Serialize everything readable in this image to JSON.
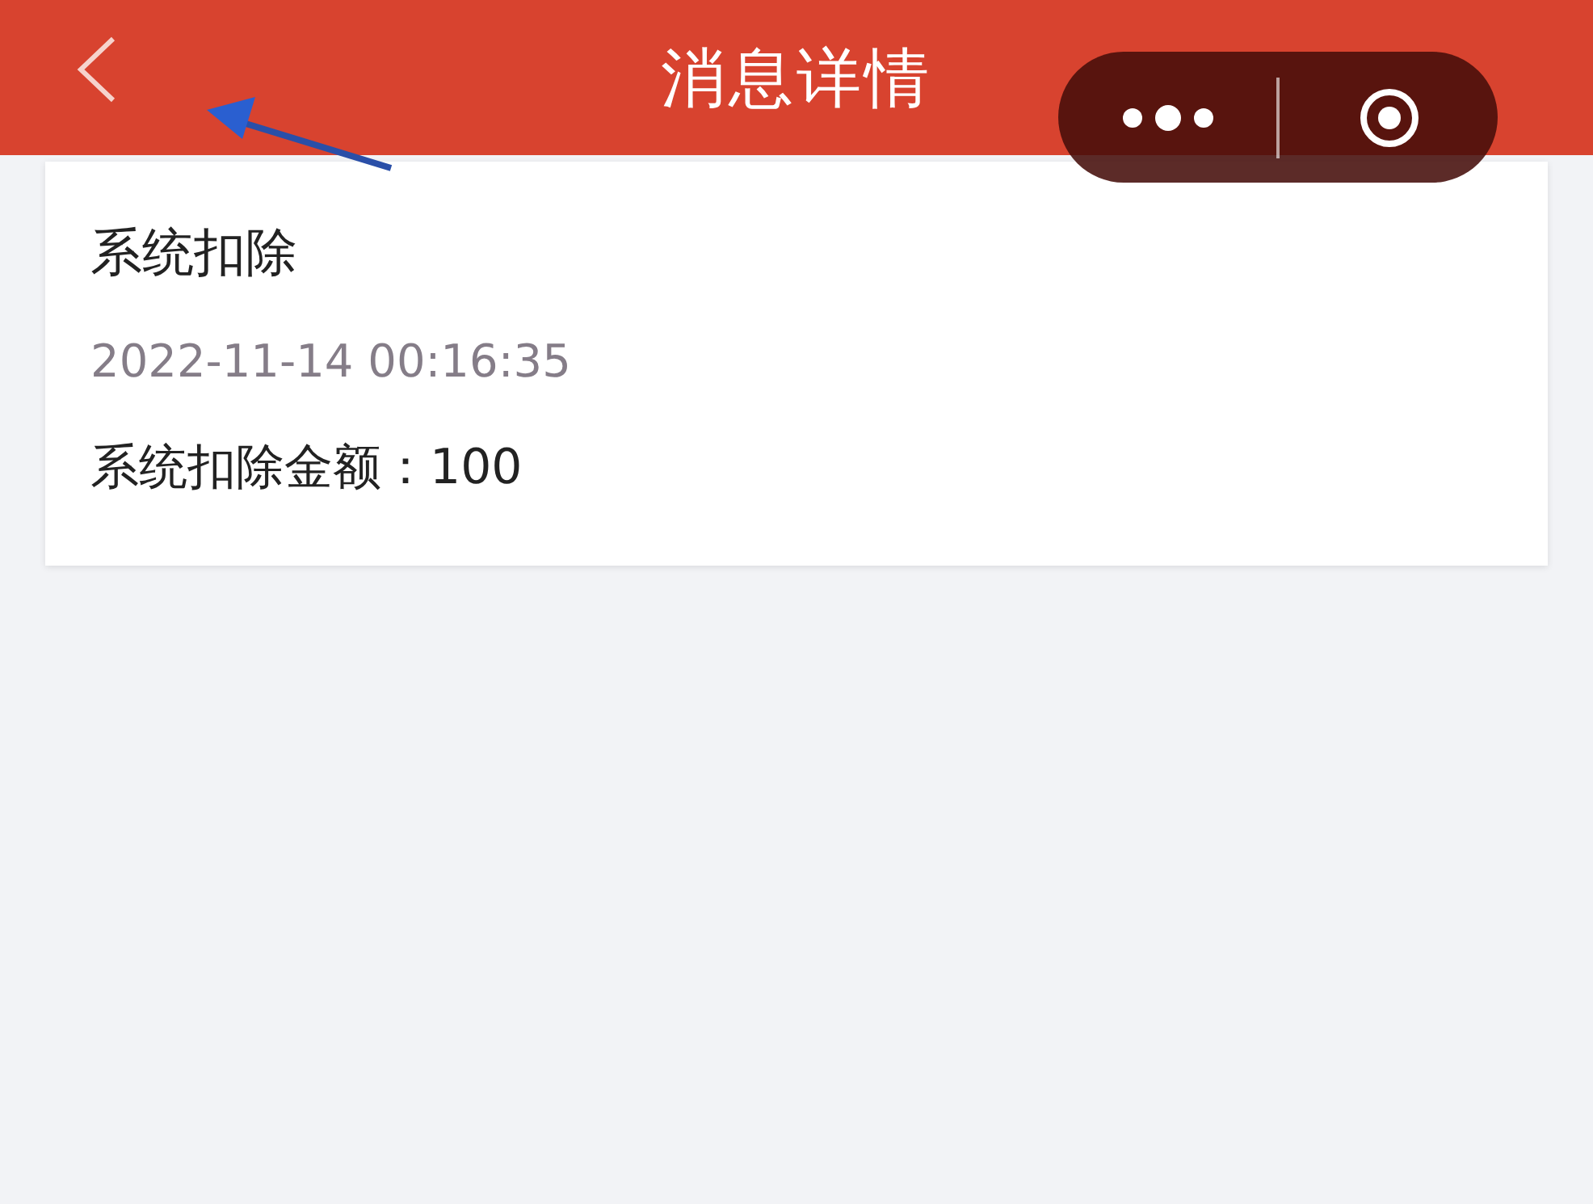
{
  "header": {
    "title": "消息详情"
  },
  "message": {
    "title": "系统扣除",
    "time": "2022-11-14 00:16:35",
    "detail": "系统扣除金额：100"
  }
}
